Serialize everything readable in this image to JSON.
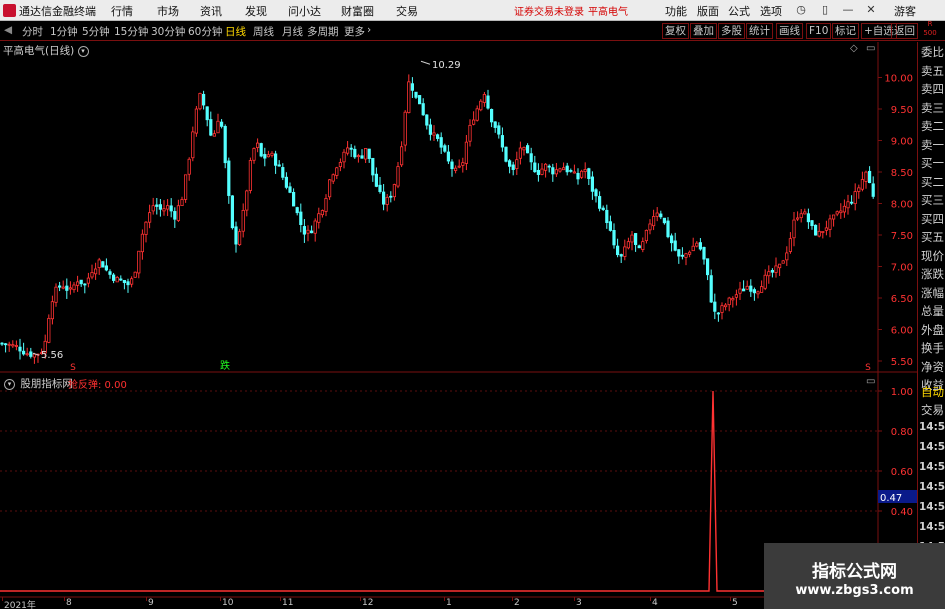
{
  "menubar": {
    "app_title": "通达信金融终端",
    "items": [
      "行情",
      "市场",
      "资讯",
      "发现",
      "问小达",
      "财富圈",
      "交易"
    ],
    "notice": "证券交易未登录",
    "stock_name": "平高电气",
    "right_items": [
      "功能",
      "版面",
      "公式",
      "选项"
    ],
    "guest_label": "游客"
  },
  "toolbar": {
    "timeframes": [
      "分时",
      "1分钟",
      "5分钟",
      "15分钟",
      "30分钟",
      "60分钟",
      "日线",
      "周线",
      "月线",
      "多周期",
      "更多"
    ],
    "active_timeframe": "日线",
    "buttons": [
      "复权",
      "叠加",
      "多股",
      "统计",
      "画线",
      "F10",
      "标记",
      "+自选",
      "返回"
    ],
    "corner_top": "R",
    "corner_bottom": "500"
  },
  "main_pane": {
    "title": "平高电气(日线)",
    "high_label": "10.29",
    "low_label": "5.56",
    "marker_s": "S",
    "marker_die": "跌"
  },
  "indicator_pane": {
    "title": "股朋指标网",
    "value_text": "抢反弹: 0.00",
    "cursor_value": "0.47"
  },
  "right_strip": {
    "items": [
      "委比",
      "卖五",
      "卖四",
      "卖三",
      "卖二",
      "卖一",
      "买一",
      "买二",
      "买三",
      "买四",
      "买五",
      "现价",
      "涨跌",
      "涨幅",
      "总量",
      "外盘",
      "换手",
      "净资",
      "收益"
    ],
    "trade_items": [
      "自动",
      "交易"
    ],
    "times": [
      "14:56",
      "14:56",
      "14:56",
      "14:56",
      "14:56",
      "14:56",
      "14:56",
      "14:56",
      "14:56",
      "14:56"
    ]
  },
  "watermark": {
    "title": "指标公式网",
    "url": "www.zbgs3.com"
  },
  "colors": {
    "up": "#ff3232",
    "down": "#54ffff",
    "frame": "#7a1010",
    "highlight": "#ffd800"
  },
  "chart_data": [
    {
      "type": "candlestick",
      "title": "平高电气(日线)",
      "y_ticks": [
        5.5,
        6.0,
        6.5,
        7.0,
        7.5,
        8.0,
        8.5,
        9.0,
        9.5,
        10.0
      ],
      "ylim": [
        5.4,
        10.55
      ],
      "x_months": [
        "2021年",
        "8",
        "9",
        "10",
        "11",
        "12",
        "1",
        "2",
        "3",
        "4",
        "5"
      ],
      "annotations": [
        {
          "text": "10.29",
          "x": "peak (Dec)",
          "y": 10.29
        },
        {
          "text": "5.56",
          "x": "Jul start",
          "y": 5.56
        }
      ],
      "close_path": [
        [
          0,
          5.78
        ],
        [
          8,
          5.76
        ],
        [
          18,
          5.72
        ],
        [
          26,
          5.63
        ],
        [
          34,
          5.6
        ],
        [
          40,
          5.64
        ],
        [
          44,
          5.7
        ],
        [
          47,
          5.95
        ],
        [
          50,
          6.4
        ],
        [
          55,
          6.6
        ],
        [
          62,
          6.72
        ],
        [
          70,
          6.6
        ],
        [
          78,
          6.8
        ],
        [
          85,
          6.7
        ],
        [
          92,
          6.95
        ],
        [
          100,
          7.1
        ],
        [
          108,
          6.9
        ],
        [
          116,
          6.8
        ],
        [
          124,
          6.75
        ],
        [
          130,
          6.7
        ],
        [
          136,
          7.0
        ],
        [
          140,
          7.4
        ],
        [
          146,
          7.7
        ],
        [
          154,
          8.0
        ],
        [
          160,
          7.9
        ],
        [
          168,
          7.95
        ],
        [
          175,
          7.8
        ],
        [
          182,
          8.1
        ],
        [
          188,
          8.6
        ],
        [
          194,
          9.3
        ],
        [
          200,
          9.7
        ],
        [
          204,
          9.55
        ],
        [
          208,
          9.3
        ],
        [
          212,
          9.0
        ],
        [
          216,
          9.2
        ],
        [
          220,
          9.5
        ],
        [
          224,
          8.8
        ],
        [
          228,
          8.2
        ],
        [
          232,
          7.6
        ],
        [
          236,
          7.4
        ],
        [
          240,
          7.6
        ],
        [
          244,
          7.9
        ],
        [
          250,
          8.6
        ],
        [
          256,
          9.0
        ],
        [
          262,
          8.7
        ],
        [
          270,
          8.8
        ],
        [
          278,
          8.6
        ],
        [
          286,
          8.3
        ],
        [
          292,
          8.1
        ],
        [
          300,
          7.7
        ],
        [
          306,
          7.5
        ],
        [
          312,
          7.6
        ],
        [
          318,
          7.8
        ],
        [
          324,
          8.0
        ],
        [
          330,
          8.4
        ],
        [
          336,
          8.6
        ],
        [
          342,
          8.7
        ],
        [
          348,
          8.9
        ],
        [
          354,
          8.8
        ],
        [
          360,
          8.7
        ],
        [
          366,
          8.9
        ],
        [
          372,
          8.5
        ],
        [
          378,
          8.2
        ],
        [
          384,
          8.0
        ],
        [
          390,
          8.1
        ],
        [
          396,
          8.4
        ],
        [
          402,
          9.0
        ],
        [
          406,
          9.6
        ],
        [
          410,
          10.05
        ],
        [
          414,
          9.7
        ],
        [
          420,
          9.6
        ],
        [
          426,
          9.3
        ],
        [
          432,
          9.1
        ],
        [
          438,
          9.0
        ],
        [
          444,
          8.8
        ],
        [
          450,
          8.6
        ],
        [
          456,
          8.5
        ],
        [
          462,
          8.6
        ],
        [
          468,
          9.1
        ],
        [
          474,
          9.4
        ],
        [
          480,
          9.6
        ],
        [
          484,
          9.8
        ],
        [
          490,
          9.4
        ],
        [
          496,
          9.2
        ],
        [
          502,
          8.9
        ],
        [
          508,
          8.6
        ],
        [
          514,
          8.5
        ],
        [
          520,
          8.9
        ],
        [
          526,
          8.8
        ],
        [
          532,
          8.6
        ],
        [
          538,
          8.5
        ],
        [
          546,
          8.6
        ],
        [
          554,
          8.5
        ],
        [
          562,
          8.6
        ],
        [
          570,
          8.5
        ],
        [
          578,
          8.4
        ],
        [
          584,
          8.6
        ],
        [
          590,
          8.3
        ],
        [
          596,
          8.1
        ],
        [
          602,
          7.9
        ],
        [
          608,
          7.7
        ],
        [
          614,
          7.3
        ],
        [
          620,
          7.1
        ],
        [
          626,
          7.3
        ],
        [
          632,
          7.5
        ],
        [
          638,
          7.2
        ],
        [
          644,
          7.4
        ],
        [
          650,
          7.7
        ],
        [
          656,
          7.9
        ],
        [
          662,
          7.8
        ],
        [
          668,
          7.5
        ],
        [
          674,
          7.3
        ],
        [
          680,
          7.1
        ],
        [
          686,
          7.2
        ],
        [
          692,
          7.3
        ],
        [
          698,
          7.4
        ],
        [
          704,
          7.1
        ],
        [
          708,
          6.8
        ],
        [
          712,
          6.4
        ],
        [
          716,
          6.2
        ],
        [
          720,
          6.3
        ],
        [
          726,
          6.4
        ],
        [
          732,
          6.5
        ],
        [
          740,
          6.6
        ],
        [
          748,
          6.7
        ],
        [
          756,
          6.6
        ],
        [
          764,
          6.8
        ],
        [
          772,
          6.9
        ],
        [
          780,
          7.0
        ],
        [
          788,
          7.3
        ],
        [
          794,
          7.7
        ],
        [
          800,
          7.9
        ],
        [
          806,
          7.8
        ],
        [
          812,
          7.6
        ],
        [
          818,
          7.5
        ],
        [
          824,
          7.6
        ],
        [
          830,
          7.7
        ],
        [
          836,
          7.8
        ],
        [
          842,
          7.9
        ],
        [
          848,
          8.0
        ],
        [
          854,
          8.1
        ],
        [
          860,
          8.3
        ],
        [
          866,
          8.5
        ],
        [
          872,
          8.2
        ],
        [
          876,
          8.0
        ]
      ]
    },
    {
      "type": "line",
      "title": "股朋指标网",
      "series": [
        {
          "name": "抢反弹",
          "values": [
            0,
            0,
            0,
            0,
            1,
            0,
            0,
            0
          ]
        }
      ],
      "x_positions": [
        0,
        100,
        300,
        500,
        713,
        730,
        800,
        917
      ],
      "y_ticks": [
        0.4,
        0.6,
        0.8,
        1.0
      ],
      "ylim": [
        -0.07,
        1.03
      ],
      "current_value": 0.47
    }
  ]
}
